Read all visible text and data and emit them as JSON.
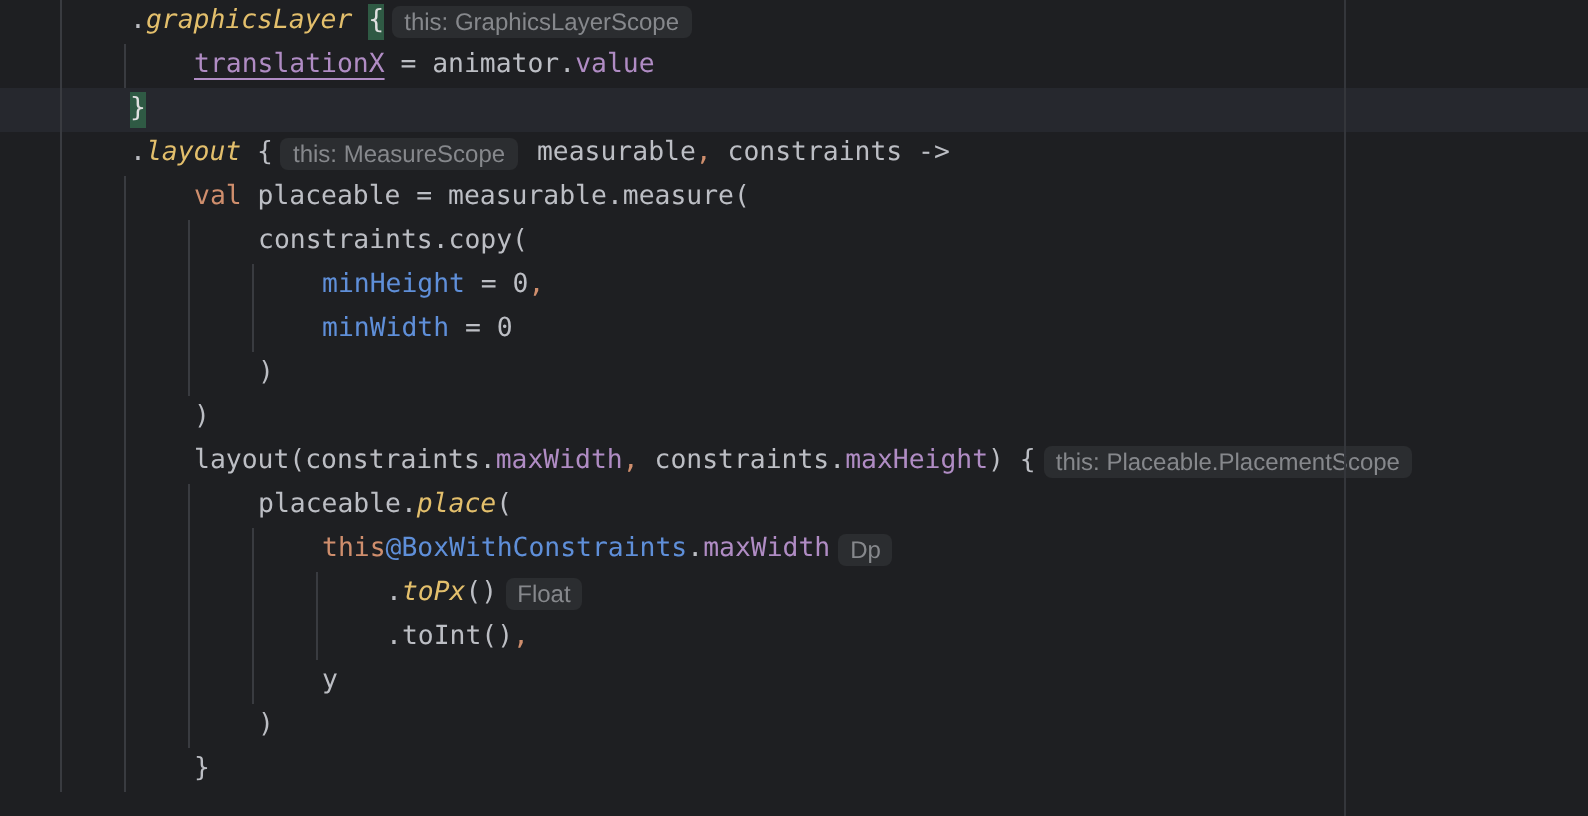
{
  "editor": {
    "lines": [
      {
        "current": false,
        "tokens": [
          {
            "kind": "plain",
            "text": "."
          },
          {
            "kind": "function",
            "text": "graphicsLayer"
          },
          {
            "kind": "brace-match",
            "text": "{"
          },
          {
            "kind": "hint",
            "text": "this: GraphicsLayerScope"
          }
        ],
        "children": [
          {
            "current": false,
            "tokens": [
              {
                "kind": "property-underlined",
                "text": "translationX"
              },
              {
                "kind": "plain",
                "text": " = animator."
              },
              {
                "kind": "property",
                "text": "value"
              }
            ]
          }
        ]
      },
      {
        "current": true,
        "tokens": [
          {
            "kind": "brace-match",
            "text": "}"
          }
        ]
      },
      {
        "current": false,
        "tokens": [
          {
            "kind": "plain",
            "text": "."
          },
          {
            "kind": "function",
            "text": "layout"
          },
          {
            "kind": "plain",
            "text": " {"
          },
          {
            "kind": "hint",
            "text": "this: MeasureScope"
          },
          {
            "kind": "plain",
            "text": " measurable"
          },
          {
            "kind": "comma",
            "text": ","
          },
          {
            "kind": "plain",
            "text": " constraints ->"
          }
        ],
        "children": [
          {
            "current": false,
            "tokens": [
              {
                "kind": "keyword",
                "text": "val"
              },
              {
                "kind": "plain",
                "text": " placeable = measurable.measure("
              }
            ],
            "children": [
              {
                "current": false,
                "tokens": [
                  {
                    "kind": "plain",
                    "text": "constraints.copy("
                  }
                ],
                "children": [
                  {
                    "current": false,
                    "tokens": [
                      {
                        "kind": "named-argument",
                        "text": "minHeight"
                      },
                      {
                        "kind": "plain",
                        "text": " = 0"
                      },
                      {
                        "kind": "comma",
                        "text": ","
                      }
                    ]
                  },
                  {
                    "current": false,
                    "tokens": [
                      {
                        "kind": "named-argument",
                        "text": "minWidth"
                      },
                      {
                        "kind": "plain",
                        "text": " = 0"
                      }
                    ]
                  }
                ]
              },
              {
                "current": false,
                "tokens": [
                  {
                    "kind": "plain",
                    "text": ")"
                  }
                ]
              }
            ]
          },
          {
            "current": false,
            "tokens": [
              {
                "kind": "plain",
                "text": ")"
              }
            ]
          },
          {
            "current": false,
            "tokens": [
              {
                "kind": "plain",
                "text": "layout(constraints."
              },
              {
                "kind": "property",
                "text": "maxWidth"
              },
              {
                "kind": "comma",
                "text": ","
              },
              {
                "kind": "plain",
                "text": " constraints."
              },
              {
                "kind": "property",
                "text": "maxHeight"
              },
              {
                "kind": "plain",
                "text": ") {"
              },
              {
                "kind": "hint",
                "text": "this: Placeable.PlacementScope"
              }
            ],
            "children": [
              {
                "current": false,
                "tokens": [
                  {
                    "kind": "plain",
                    "text": "placeable."
                  },
                  {
                    "kind": "function",
                    "text": "place"
                  },
                  {
                    "kind": "plain",
                    "text": "("
                  }
                ],
                "children": [
                  {
                    "current": false,
                    "tokens": [
                      {
                        "kind": "keyword",
                        "text": "this"
                      },
                      {
                        "kind": "label",
                        "text": "@BoxWithConstraints"
                      },
                      {
                        "kind": "plain",
                        "text": "."
                      },
                      {
                        "kind": "property",
                        "text": "maxWidth"
                      },
                      {
                        "kind": "hint",
                        "text": "Dp"
                      }
                    ],
                    "children": [
                      {
                        "current": false,
                        "tokens": [
                          {
                            "kind": "plain",
                            "text": "."
                          },
                          {
                            "kind": "function",
                            "text": "toPx"
                          },
                          {
                            "kind": "plain",
                            "text": "()"
                          },
                          {
                            "kind": "hint",
                            "text": "Float"
                          }
                        ]
                      },
                      {
                        "current": false,
                        "tokens": [
                          {
                            "kind": "plain",
                            "text": ".toInt()"
                          },
                          {
                            "kind": "comma",
                            "text": ","
                          }
                        ]
                      }
                    ]
                  },
                  {
                    "current": false,
                    "tokens": [
                      {
                        "kind": "plain",
                        "text": "y"
                      }
                    ]
                  }
                ]
              },
              {
                "current": false,
                "tokens": [
                  {
                    "kind": "plain",
                    "text": ")"
                  }
                ]
              }
            ]
          },
          {
            "current": false,
            "tokens": [
              {
                "kind": "plain",
                "text": "}"
              }
            ]
          }
        ]
      }
    ]
  }
}
